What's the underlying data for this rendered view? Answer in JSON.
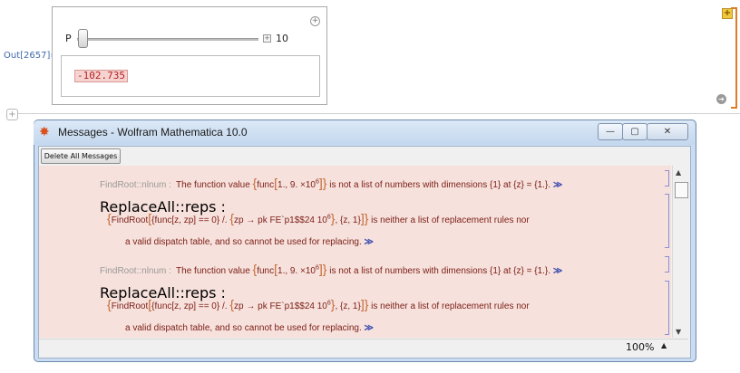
{
  "notebook": {
    "out_label": "Out[2657]=",
    "manipulate": {
      "plus_symbol": "+",
      "slider_label": "P",
      "slider_value": "10",
      "slider_position": 0.0,
      "expand_symbol": "+",
      "result_value": "-102.735"
    },
    "warning_badge": "+",
    "arrow_symbol": "➔",
    "insert_symbol": "+"
  },
  "messages_window": {
    "title": "Messages - Wolfram Mathematica 10.0",
    "buttons": {
      "minimize": "—",
      "maximize": "▢",
      "close": "✕"
    },
    "delete_all_label": "Delete All Messages",
    "zoom": "100%",
    "zoom_arrow": "▲",
    "scroll_up": "▲",
    "scroll_down": "▼",
    "messages": [
      {
        "tag": "FindRoot::nlnum :",
        "line1_a": "The function value",
        "expr_a": "func",
        "expr_b": "1., 9. ×10",
        "expr_sup": "6",
        "line1_b": "is not a list of numbers with dimensions {1} at {z} = {1.}.",
        "more": "≫"
      },
      {
        "tag": "ReplaceAll::reps :",
        "expr_findroot": "FindRoot",
        "expr_inner": "{func[z, zp] == 0} /.",
        "expr_rule": "zp → pk FE`p1$$24 10",
        "expr_sup": "6",
        "expr_tail": ", {z, 1}",
        "line1_b": "is neither a list of replacement rules nor",
        "line2": "a valid dispatch table, and so cannot be used for replacing.",
        "more": "≫"
      },
      {
        "tag": "FindRoot::nlnum :",
        "line1_a": "The function value",
        "expr_a": "func",
        "expr_b": "1., 9. ×10",
        "expr_sup": "6",
        "line1_b": "is not a list of numbers with dimensions {1} at {z} = {1.}.",
        "more": "≫"
      },
      {
        "tag": "ReplaceAll::reps :",
        "expr_findroot": "FindRoot",
        "expr_inner": "{func[z, zp] == 0} /.",
        "expr_rule": "zp → pk FE`p1$$24 10",
        "expr_sup": "6",
        "expr_tail": ", {z, 1}",
        "line1_b": "is neither a list of replacement rules nor",
        "line2": "a valid dispatch table, and so cannot be used for replacing.",
        "more": "≫"
      }
    ]
  },
  "colors": {
    "message_background": "#f7e1dc",
    "message_text": "#7a1e16",
    "bracket_orange": "#e07b26",
    "title_bar": "#c9dcf1"
  }
}
